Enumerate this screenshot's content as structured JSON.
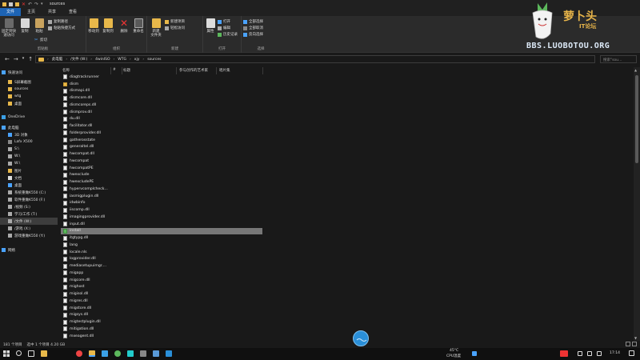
{
  "window": {
    "title": "sources"
  },
  "colors": {
    "accent": "#1d64b5",
    "folder": "#e8b84a",
    "selected_row": "#777777",
    "bg": "#191919"
  },
  "tabs": [
    "文件",
    "主页",
    "共享",
    "查看"
  ],
  "ribbon": {
    "pin_label": "固定到快速访问",
    "copy_label": "复制",
    "paste_label": "粘贴",
    "copy_path": "复制路径",
    "paste_shortcut": "粘贴快捷方式",
    "cut": "剪切",
    "clipboard_group": "剪贴板",
    "move_to": "移动到",
    "copy_to": "复制到",
    "delete": "删除",
    "rename": "重命名",
    "organize_group": "组织",
    "new_folder": "新建\n文件夹",
    "new_item": "新建项目",
    "easy_access": "轻松访问",
    "new_group": "新建",
    "properties": "属性",
    "open": "打开",
    "edit": "编辑",
    "history": "历史记录",
    "open_group": "打开",
    "select_all": "全部选择",
    "select_none": "全部取消",
    "invert": "反向选择",
    "select_group": "选择"
  },
  "address": {
    "segments": [
      "此电脑",
      "/文件 (W:)",
      "4winISO",
      "WTG",
      "xjy",
      "sources"
    ],
    "search_placeholder": "搜索\"sou..."
  },
  "sidebar": {
    "items": [
      {
        "label": "快速访问",
        "icon": "star-icon"
      },
      {
        "label": "S屏幕截图",
        "icon": "folder-icon"
      },
      {
        "label": "sources",
        "icon": "folder-icon"
      },
      {
        "label": "wtg",
        "icon": "folder-icon"
      },
      {
        "label": "桌面",
        "icon": "folder-icon"
      },
      {
        "label": "OneDrive",
        "icon": "cloud-icon"
      },
      {
        "label": "此电脑",
        "icon": "pc-icon"
      },
      {
        "label": "3D 对象",
        "icon": "cube-icon"
      },
      {
        "label": "Lafx X500",
        "icon": "device-icon"
      },
      {
        "label": "S:\\",
        "icon": "drive-icon"
      },
      {
        "label": "W:\\",
        "icon": "drive-icon"
      },
      {
        "label": "W:\\",
        "icon": "drive-icon"
      },
      {
        "label": "图片",
        "icon": "pictures-icon"
      },
      {
        "label": "文档",
        "icon": "docs-icon"
      },
      {
        "label": "桌面",
        "icon": "desktop-icon"
      },
      {
        "label": "系统重做K550 (C:)",
        "icon": "drive-icon"
      },
      {
        "label": "软件重做K550 (F:)",
        "icon": "drive-icon"
      },
      {
        "label": "/视频 (S:)",
        "icon": "drive-icon"
      },
      {
        "label": "学习/工作 (T:)",
        "icon": "drive-icon"
      },
      {
        "label": "/文件 (W:)",
        "icon": "drive-icon"
      },
      {
        "label": "/游戏 (X:)",
        "icon": "drive-icon"
      },
      {
        "label": "游戏重做K550 (Y:)",
        "icon": "drive-icon"
      },
      {
        "label": "网络",
        "icon": "network-icon"
      }
    ]
  },
  "columns": [
    "名称",
    "#",
    "标题",
    "参与创作的艺术家",
    "唱片集"
  ],
  "files": [
    {
      "name": "diagtrackrunner",
      "type": "file"
    },
    {
      "name": "dism",
      "type": "folder"
    },
    {
      "name": "dismapi.dll",
      "type": "file"
    },
    {
      "name": "dismcore.dll",
      "type": "file"
    },
    {
      "name": "dismcoreps.dll",
      "type": "file"
    },
    {
      "name": "dismprov.dll",
      "type": "file"
    },
    {
      "name": "du.dll",
      "type": "file"
    },
    {
      "name": "facilitator.dll",
      "type": "file"
    },
    {
      "name": "folderprovider.dll",
      "type": "file"
    },
    {
      "name": "gatherosstate",
      "type": "file"
    },
    {
      "name": "generaltel.dll",
      "type": "file"
    },
    {
      "name": "hwcompat.dll",
      "type": "file"
    },
    {
      "name": "hwcompat",
      "type": "file"
    },
    {
      "name": "hwcompatPE",
      "type": "file"
    },
    {
      "name": "hwexclude",
      "type": "file"
    },
    {
      "name": "hwexcludePE",
      "type": "file"
    },
    {
      "name": "hypervcomplcheck...",
      "type": "file"
    },
    {
      "name": "iasmigplugin.dll",
      "type": "file"
    },
    {
      "name": "idwbinfo",
      "type": "file"
    },
    {
      "name": "iiscomp.dll",
      "type": "file"
    },
    {
      "name": "imagingprovider.dll",
      "type": "file"
    },
    {
      "name": "input.dll",
      "type": "file"
    },
    {
      "name": "install",
      "type": "file",
      "selected": true
    },
    {
      "name": "itgtypg.dll",
      "type": "file"
    },
    {
      "name": "lang",
      "type": "file"
    },
    {
      "name": "locale.nls",
      "type": "file"
    },
    {
      "name": "logprovider.dll",
      "type": "file"
    },
    {
      "name": "mediasetupuimgr....",
      "type": "file"
    },
    {
      "name": "migapp",
      "type": "file"
    },
    {
      "name": "migcore.dll",
      "type": "file"
    },
    {
      "name": "mighost",
      "type": "file"
    },
    {
      "name": "migisol.dll",
      "type": "file"
    },
    {
      "name": "migres.dll",
      "type": "file"
    },
    {
      "name": "migstore.dll",
      "type": "file"
    },
    {
      "name": "migsys.dll",
      "type": "file"
    },
    {
      "name": "migtestplugin.dll",
      "type": "file"
    },
    {
      "name": "mitigation.dll",
      "type": "file"
    },
    {
      "name": "mxeagent.dll",
      "type": "file"
    }
  ],
  "status": {
    "count": "181 个项目",
    "selected": "选中 1 个项目  4.20 GB"
  },
  "taskbar": {
    "temp": "45°C",
    "temp_label": "CPU温度",
    "time": "17:14"
  },
  "watermark": {
    "line1": "萝卜头",
    "line2": "IT论坛",
    "line3": "BBS.LUOBOTOU.ORG"
  }
}
